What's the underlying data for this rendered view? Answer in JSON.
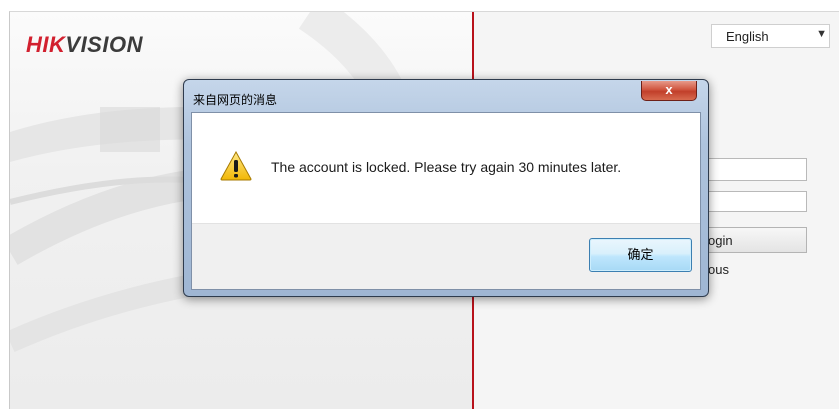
{
  "background_page": {
    "logo": {
      "part1": "HIK",
      "part2": "VISION"
    },
    "language_select": {
      "value": "English"
    },
    "login_button_partial_label": "ogin",
    "partial_text": "ous"
  },
  "dialog": {
    "title": "来自网页的消息",
    "close_label": "x",
    "message": "The account is locked. Please try again 30 minutes later.",
    "icon": "warning-icon",
    "ok_label": "确定"
  },
  "colors": {
    "brand_red": "#d2202f",
    "divider_red": "#b8121b",
    "dialog_frame": "#aec3dd"
  }
}
